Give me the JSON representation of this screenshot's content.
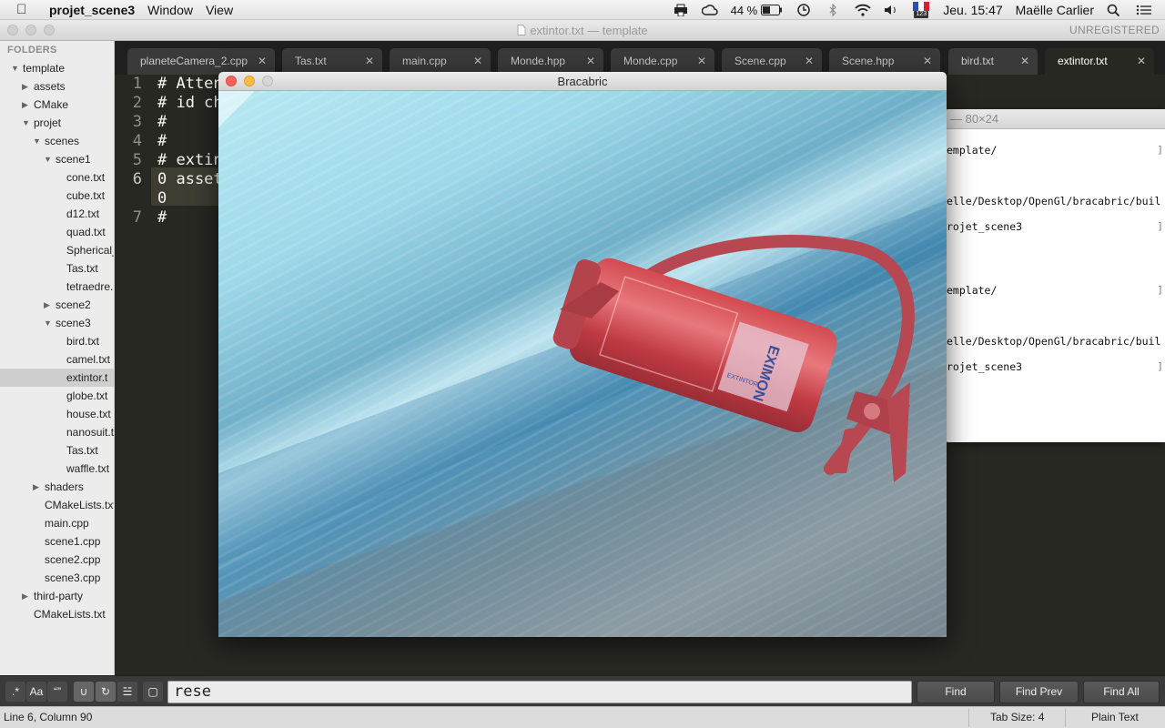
{
  "menubar": {
    "app_name": "projet_scene3",
    "menus": [
      "Window",
      "View"
    ],
    "battery": "44 %",
    "keyboard_badge": "123",
    "datetime": "Jeu. 15:47",
    "user": "Maëlle Carlier"
  },
  "window": {
    "title": "extintor.txt — template",
    "unregistered": "UNREGISTERED"
  },
  "sidebar": {
    "header": "FOLDERS",
    "items": [
      {
        "label": "template",
        "indent": 0,
        "arrow": "down"
      },
      {
        "label": "assets",
        "indent": 1,
        "arrow": "right"
      },
      {
        "label": "CMake",
        "indent": 1,
        "arrow": "right"
      },
      {
        "label": "projet",
        "indent": 1,
        "arrow": "down"
      },
      {
        "label": "scenes",
        "indent": 2,
        "arrow": "down"
      },
      {
        "label": "scene1",
        "indent": 3,
        "arrow": "down"
      },
      {
        "label": "cone.txt",
        "indent": 4,
        "arrow": ""
      },
      {
        "label": "cube.txt",
        "indent": 4,
        "arrow": ""
      },
      {
        "label": "d12.txt",
        "indent": 4,
        "arrow": ""
      },
      {
        "label": "quad.txt",
        "indent": 4,
        "arrow": ""
      },
      {
        "label": "Spherical_",
        "indent": 4,
        "arrow": ""
      },
      {
        "label": "Tas.txt",
        "indent": 4,
        "arrow": ""
      },
      {
        "label": "tetraedre.",
        "indent": 4,
        "arrow": ""
      },
      {
        "label": "scene2",
        "indent": 3,
        "arrow": "right"
      },
      {
        "label": "scene3",
        "indent": 3,
        "arrow": "down"
      },
      {
        "label": "bird.txt",
        "indent": 4,
        "arrow": ""
      },
      {
        "label": "camel.txt",
        "indent": 4,
        "arrow": ""
      },
      {
        "label": "extintor.t",
        "indent": 4,
        "arrow": "",
        "selected": true
      },
      {
        "label": "globe.txt",
        "indent": 4,
        "arrow": ""
      },
      {
        "label": "house.txt",
        "indent": 4,
        "arrow": ""
      },
      {
        "label": "nanosuit.t",
        "indent": 4,
        "arrow": ""
      },
      {
        "label": "Tas.txt",
        "indent": 4,
        "arrow": ""
      },
      {
        "label": "waffle.txt",
        "indent": 4,
        "arrow": ""
      },
      {
        "label": "shaders",
        "indent": 2,
        "arrow": "right"
      },
      {
        "label": "CMakeLists.txt",
        "indent": 2,
        "arrow": ""
      },
      {
        "label": "main.cpp",
        "indent": 2,
        "arrow": ""
      },
      {
        "label": "scene1.cpp",
        "indent": 2,
        "arrow": ""
      },
      {
        "label": "scene2.cpp",
        "indent": 2,
        "arrow": ""
      },
      {
        "label": "scene3.cpp",
        "indent": 2,
        "arrow": ""
      },
      {
        "label": "third-party",
        "indent": 1,
        "arrow": "right"
      },
      {
        "label": "CMakeLists.txt",
        "indent": 1,
        "arrow": ""
      }
    ]
  },
  "tabs": [
    {
      "label": "planeteCamera_2.cpp",
      "active": false
    },
    {
      "label": "Tas.txt",
      "active": false
    },
    {
      "label": "main.cpp",
      "active": false
    },
    {
      "label": "Monde.hpp",
      "active": false
    },
    {
      "label": "Monde.cpp",
      "active": false
    },
    {
      "label": "Scene.cpp",
      "active": false
    },
    {
      "label": "Scene.hpp",
      "active": false
    },
    {
      "label": "bird.txt",
      "active": false
    },
    {
      "label": "extintor.txt",
      "active": true
    }
  ],
  "editor": {
    "lines": [
      {
        "number": "1",
        "text": "# Atten"
      },
      {
        "number": "2",
        "text": "# id ch"
      },
      {
        "number": "3",
        "text": "#"
      },
      {
        "number": "4",
        "text": "#"
      },
      {
        "number": "5",
        "text": "# extin"
      },
      {
        "number": "6",
        "text": "0 asset",
        "current": true
      },
      {
        "number": "",
        "text": "0",
        "current": true
      },
      {
        "number": "7",
        "text": "#"
      }
    ]
  },
  "terminal": {
    "title": "— 80×24",
    "lines": [
      {
        "text": "emplate/",
        "mark": "]"
      },
      {
        "text": "elle/Desktop/OpenGl/bracabric/buil",
        "mark": ""
      },
      {
        "text": "rojet_scene3",
        "mark": "]"
      },
      {
        "text": "emplate/",
        "mark": "]"
      },
      {
        "text": "elle/Desktop/OpenGl/bracabric/buil",
        "mark": ""
      },
      {
        "text": "rojet_scene3",
        "mark": "]"
      }
    ]
  },
  "gl_window": {
    "title": "Bracabric",
    "label_brand": "EXTINTOR",
    "label_logo": "EXIMON"
  },
  "findbar": {
    "options": [
      ".*",
      "Aa",
      "“”",
      "∪",
      "↻",
      "☱",
      "▢"
    ],
    "query": "rese",
    "find": "Find",
    "find_prev": "Find Prev",
    "find_all": "Find All"
  },
  "statusbar": {
    "position": "Line 6, Column 90",
    "tab_size": "Tab Size: 4",
    "syntax": "Plain Text"
  }
}
